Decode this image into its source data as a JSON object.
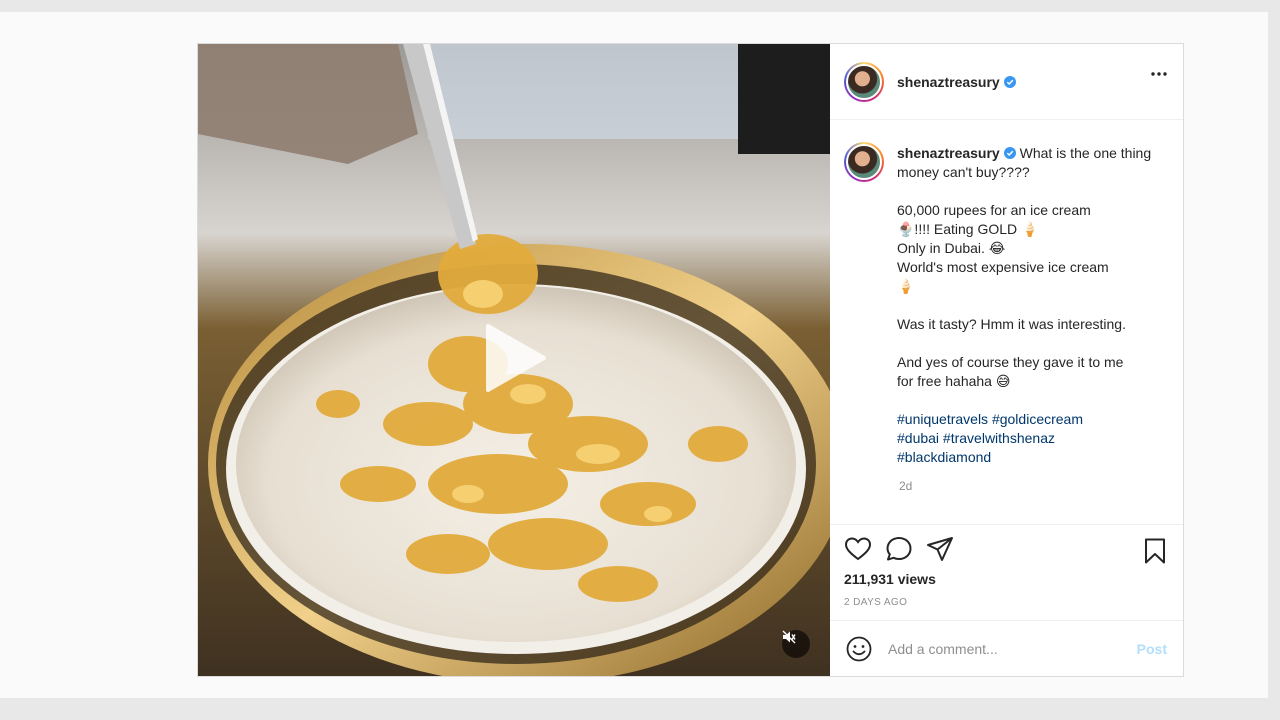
{
  "post": {
    "username": "shenaztreasury",
    "caption_lines": [
      "What is the one thing money can't buy????",
      "",
      "60,000 rupees for an ice cream 🍨!!!! Eating GOLD 🍦",
      "Only in Dubai. 😂",
      "World's most expensive ice cream 🍦",
      "",
      "Was it tasty? Hmm it was interesting.",
      "",
      "And yes of course they gave it to me for free hahaha 😅"
    ],
    "caption_first": "What is the one thing money can't buy????",
    "caption_body": "60,000 rupees for an ice cream\n🍨!!!! Eating GOLD 🍦\nOnly in Dubai. 😂\nWorld's most expensive ice cream\n🍦\n\nWas it tasty? Hmm it was interesting.\n\nAnd yes of course they gave it to me\nfor free hahaha 😅",
    "hashtags": "#uniquetravels #goldicecream\n#dubai #travelwithshenaz\n#blackdiamond",
    "relative_time": "2d",
    "views": "211,931 views",
    "posted_ago": "2 DAYS AGO"
  },
  "comment_box": {
    "placeholder": "Add a comment...",
    "post_label": "Post"
  },
  "colors": {
    "verified": "#3897f0",
    "hashtag": "#00376b",
    "post_disabled": "#b2dffc",
    "muted": "#8e8e8e"
  },
  "icons": [
    "verified-badge-icon",
    "more-options-icon",
    "play-icon",
    "mute-icon",
    "heart-icon",
    "comment-icon",
    "share-icon",
    "bookmark-icon",
    "emoji-icon"
  ]
}
